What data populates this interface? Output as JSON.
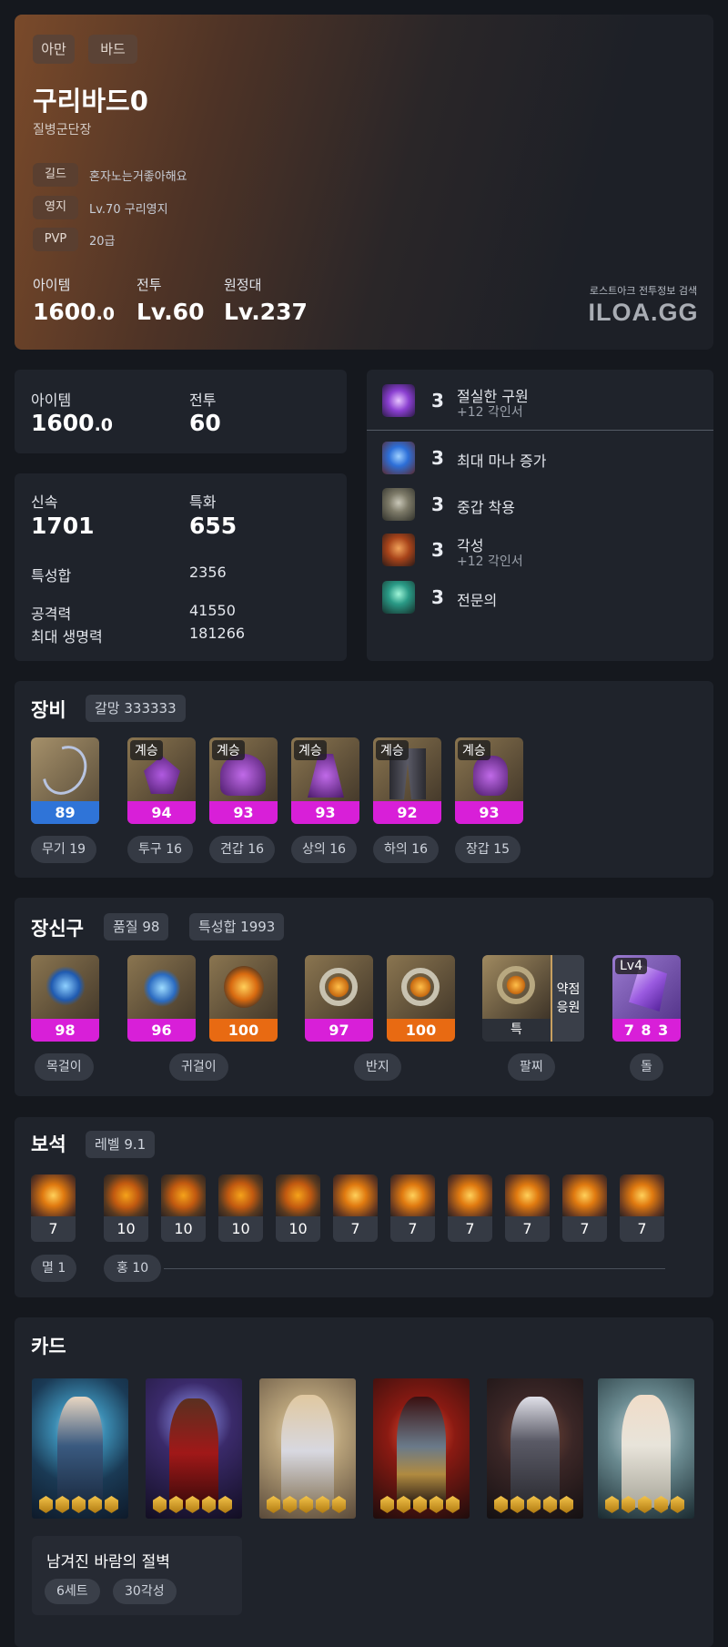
{
  "profile": {
    "server": "아만",
    "class": "바드",
    "name": "구리바드0",
    "title": "질병군단장",
    "rows": [
      {
        "key": "길드",
        "value": "혼자노는거좋아해요"
      },
      {
        "key": "영지",
        "value": "Lv.70 구리영지"
      },
      {
        "key": "PVP",
        "value": "20급"
      }
    ],
    "item_label": "아이템",
    "item_int": "1600",
    "item_dec": ".0",
    "combat_label": "전투",
    "combat_value": "Lv.60",
    "expedition_label": "원정대",
    "expedition_value": "Lv.237",
    "brand_caption": "로스트아크 전투정보 검색",
    "brand_logo": "ILOA.GG"
  },
  "level_card": {
    "item_label": "아이템",
    "item_int": "1600",
    "item_dec": ".0",
    "combat_label": "전투",
    "combat_value": "60"
  },
  "stats": {
    "speed_label": "신속",
    "speed_value": "1701",
    "spec_label": "특화",
    "spec_value": "655",
    "sum_label": "특성합",
    "sum_value": "2356",
    "atk_label": "공격력",
    "atk_value": "41550",
    "hp_label": "최대 생명력",
    "hp_value": "181266"
  },
  "engravings": [
    {
      "level": "3",
      "name": "절실한 구원",
      "sub": "+12 각인서",
      "icon": "engrave-purple-icon"
    },
    {
      "level": "3",
      "name": "최대 마나 증가",
      "sub": "",
      "icon": "engrave-blue-icon"
    },
    {
      "level": "3",
      "name": "중갑 착용",
      "sub": "",
      "icon": "engrave-armor-icon"
    },
    {
      "level": "3",
      "name": "각성",
      "sub": "+12 각인서",
      "icon": "engrave-face-icon"
    },
    {
      "level": "3",
      "name": "전문의",
      "sub": "",
      "icon": "engrave-green-icon"
    }
  ],
  "equipment": {
    "title": "장비",
    "badge": "갈망 333333",
    "items": [
      {
        "tag": "",
        "quality": "89",
        "label": "무기 19",
        "color": "#2f74d8",
        "icon": "weapon-icon"
      },
      {
        "tag": "계승",
        "quality": "94",
        "label": "투구 16",
        "color": "#d81fd8",
        "icon": "helmet-icon"
      },
      {
        "tag": "계승",
        "quality": "93",
        "label": "견갑 16",
        "color": "#d81fd8",
        "icon": "shoulder-icon"
      },
      {
        "tag": "계승",
        "quality": "93",
        "label": "상의 16",
        "color": "#d81fd8",
        "icon": "chest-icon"
      },
      {
        "tag": "계승",
        "quality": "92",
        "label": "하의 16",
        "color": "#d81fd8",
        "icon": "pants-icon"
      },
      {
        "tag": "계승",
        "quality": "93",
        "label": "장갑 15",
        "color": "#d81fd8",
        "icon": "gloves-icon"
      }
    ]
  },
  "accessories": {
    "title": "장신구",
    "badge_quality": "품질 98",
    "badge_stats": "특성합 1993",
    "items": [
      {
        "value": "98",
        "color": "#d81fd8",
        "icon": "necklace-icon"
      },
      {
        "value": "96",
        "color": "#d81fd8",
        "icon": "earring-icon"
      },
      {
        "value": "100",
        "color": "#e86a12",
        "icon": "earring-icon"
      },
      {
        "value": "97",
        "color": "#d81fd8",
        "icon": "ring-icon"
      },
      {
        "value": "100",
        "color": "#e86a12",
        "icon": "ring-icon"
      }
    ],
    "bracelet_value": "특",
    "bracelet_side": "약점\n응원",
    "stone_tag": "Lv4",
    "stone_value": "7 8 3",
    "labels": {
      "necklace": "목걸이",
      "earring": "귀걸이",
      "ring": "반지",
      "bracelet": "팔찌",
      "stone": "돌"
    }
  },
  "gems": {
    "title": "보석",
    "badge": "레벨 9.1",
    "values": [
      "7",
      "10",
      "10",
      "10",
      "10",
      "7",
      "7",
      "7",
      "7",
      "7",
      "7"
    ],
    "label_left": "멸 1",
    "label_right": "홍 10"
  },
  "cards": {
    "title": "카드",
    "set_name": "남겨진 바람의 절벽",
    "set_count": "6세트",
    "awaken": "30각성",
    "items": [
      {
        "icon": "card-portrait-1",
        "awaken": 5
      },
      {
        "icon": "card-portrait-2",
        "awaken": 5
      },
      {
        "icon": "card-portrait-3",
        "awaken": 5
      },
      {
        "icon": "card-portrait-4",
        "awaken": 5
      },
      {
        "icon": "card-portrait-5",
        "awaken": 5
      },
      {
        "icon": "card-portrait-6",
        "awaken": 5
      }
    ]
  }
}
